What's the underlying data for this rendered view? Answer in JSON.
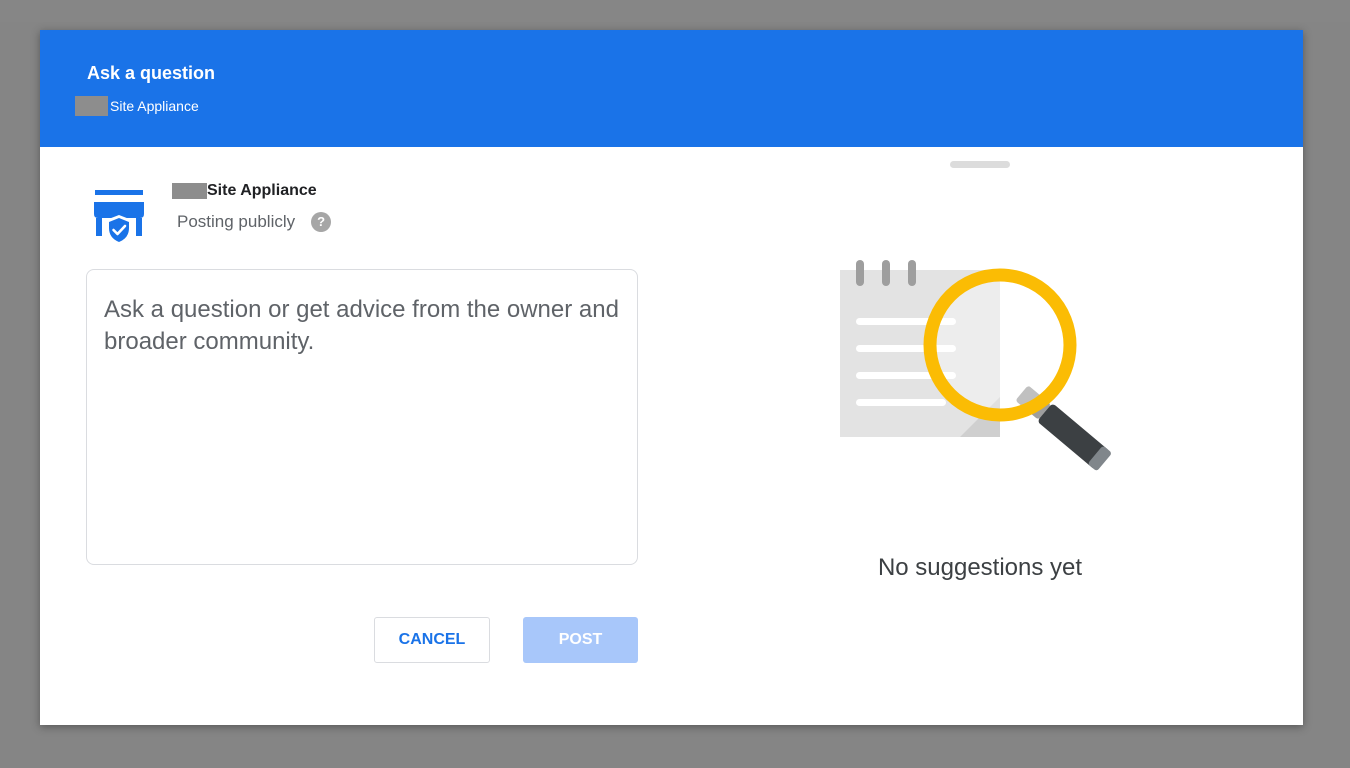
{
  "dialog": {
    "title": "Ask a question",
    "subtitle": "Site Appliance"
  },
  "business": {
    "name": "Site Appliance",
    "posting_status": "Posting publicly",
    "icon": "storefront-shield-icon",
    "help_icon": "question-mark-icon",
    "help_glyph": "?"
  },
  "question": {
    "placeholder": "Ask a question or get advice from the owner and broader community.",
    "value": ""
  },
  "actions": {
    "cancel_label": "CANCEL",
    "post_label": "POST"
  },
  "suggestions": {
    "illustration": "notepad-magnifier-illustration",
    "empty_text": "No suggestions yet"
  },
  "colors": {
    "header_bg": "#1a73e8",
    "post_disabled": "#a8c7fa",
    "magnifier_ring": "#fbbc04"
  }
}
